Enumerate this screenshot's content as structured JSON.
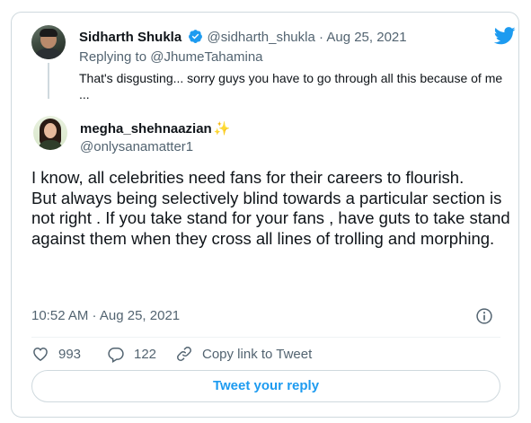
{
  "parent_tweet": {
    "display_name": "Sidharth Shukla",
    "handle": "@sidharth_shukla",
    "separator": "·",
    "date": "Aug 25, 2021",
    "replying_prefix": "Replying to",
    "replying_to": "@JhumeTahamina",
    "text": "That's disgusting... sorry guys you have to go through all this because of me ..."
  },
  "tweet": {
    "display_name": "megha_shehnaazian",
    "name_emoji": "✨",
    "handle": "@onlysanamatter1",
    "paragraphs": [
      "I know, all celebrities need fans for their careers to flourish.",
      "But always being selectively blind towards a particular section is not right . If you take stand for your fans , have guts to take stand against them when they cross all lines of trolling and morphing."
    ],
    "timestamp": "10:52 AM · Aug 25, 2021"
  },
  "actions": {
    "likes": "993",
    "replies": "122",
    "copy_link": "Copy link to Tweet"
  },
  "reply_button": "Tweet your reply",
  "colors": {
    "accent": "#1d9bf0",
    "text_primary": "#0f1419",
    "text_secondary": "#536471",
    "border": "#cfd9de"
  },
  "icons": [
    "verified-badge-icon",
    "twitter-bird-icon",
    "info-icon",
    "heart-icon",
    "reply-bubble-icon",
    "link-icon"
  ]
}
